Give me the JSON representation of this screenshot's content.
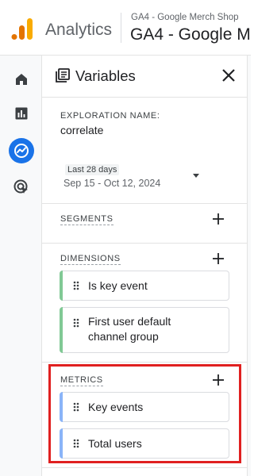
{
  "header": {
    "app_name": "Analytics",
    "account_small": "GA4 - Google Merch Shop",
    "account_big": "GA4 - Google M"
  },
  "leftnav": {
    "items": [
      {
        "icon": "home-icon",
        "active": false
      },
      {
        "icon": "reports-icon",
        "active": false
      },
      {
        "icon": "explore-icon",
        "active": true
      },
      {
        "icon": "advertising-icon",
        "active": false
      }
    ]
  },
  "panel": {
    "title": "Variables",
    "exploration_label": "EXPLORATION NAME:",
    "exploration_name": "correlate",
    "date_preset": "Last 28 days",
    "date_range": "Sep 15 - Oct 12, 2024",
    "segments_label": "SEGMENTS",
    "dimensions_label": "DIMENSIONS",
    "dimensions": [
      {
        "label": "Is key event"
      },
      {
        "label_lines": [
          "First user default",
          "channel group"
        ]
      }
    ],
    "metrics_label": "METRICS",
    "metrics": [
      {
        "label": "Key events"
      },
      {
        "label": "Total users"
      }
    ]
  },
  "colors": {
    "accent_blue": "#1a73e8",
    "dimension_green": "#81c995",
    "metric_blue": "#8ab4f8",
    "highlight_red": "#e02020"
  }
}
